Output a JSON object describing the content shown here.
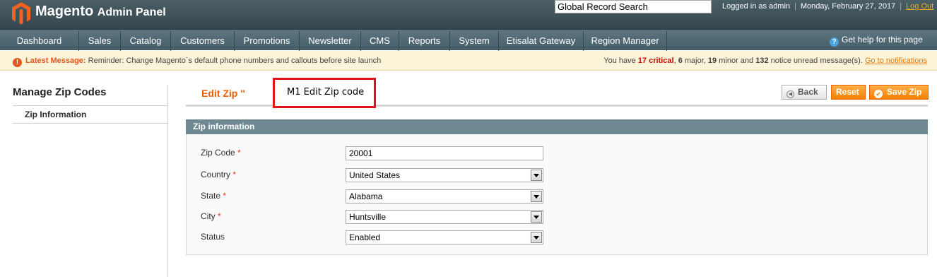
{
  "header": {
    "logo_text": "Magento",
    "logo_sub": "Admin Panel",
    "search_placeholder": "Global Record Search",
    "logged_in": "Logged in as admin",
    "date": "Monday, February 27, 2017",
    "logout": "Log Out"
  },
  "nav": {
    "items": [
      "Dashboard",
      "Sales",
      "Catalog",
      "Customers",
      "Promotions",
      "Newsletter",
      "CMS",
      "Reports",
      "System",
      "Etisalat Gateway",
      "Region Manager"
    ],
    "help": "Get help for this page"
  },
  "messages": {
    "latest_label": "Latest Message:",
    "latest_text": "Reminder: Change Magento`s default phone numbers and callouts before site launch",
    "prefix": "You have",
    "critical_count": "17",
    "critical_label": "critical",
    "major_count": "6",
    "major_label": "major,",
    "minor_count": "19",
    "minor_label": "minor and",
    "notice_count": "132",
    "notice_label": "notice unread message(s).",
    "link": "Go to notifications"
  },
  "sidebar": {
    "title": "Manage Zip Codes",
    "items": [
      "Zip Information"
    ]
  },
  "content": {
    "title": "Edit Zip ''",
    "annotation": "M1 Edit Zip code",
    "buttons": {
      "back": "Back",
      "reset": "Reset",
      "save": "Save Zip"
    },
    "fieldset_title": "Zip information",
    "fields": {
      "zip": {
        "label": "Zip Code",
        "value": "20001",
        "required": true
      },
      "country": {
        "label": "Country",
        "value": "United States",
        "required": true
      },
      "state": {
        "label": "State",
        "value": "Alabama",
        "required": true
      },
      "city": {
        "label": "City",
        "value": "Huntsville",
        "required": true
      },
      "status": {
        "label": "Status",
        "value": "Enabled",
        "required": false
      }
    }
  },
  "colors": {
    "accent_orange": "#eb5e00",
    "header_bg": "#3a4d55",
    "nav_bg": "#506873",
    "annotation_red": "#e0131d"
  }
}
